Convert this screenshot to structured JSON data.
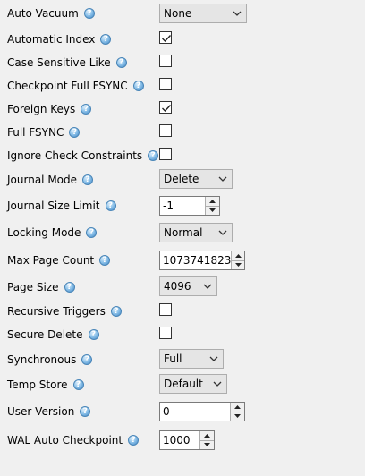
{
  "help_glyph": "?",
  "settings": {
    "auto_vacuum": {
      "label": "Auto Vacuum",
      "value": "None"
    },
    "automatic_index": {
      "label": "Automatic Index",
      "checked": true
    },
    "case_sensitive_like": {
      "label": "Case Sensitive Like",
      "checked": false
    },
    "checkpoint_full_fsync": {
      "label": "Checkpoint Full FSYNC",
      "checked": false
    },
    "foreign_keys": {
      "label": "Foreign Keys",
      "checked": true
    },
    "full_fsync": {
      "label": "Full FSYNC",
      "checked": false
    },
    "ignore_check_constraints": {
      "label": "Ignore Check Constraints",
      "checked": false
    },
    "journal_mode": {
      "label": "Journal Mode",
      "value": "Delete"
    },
    "journal_size_limit": {
      "label": "Journal Size Limit",
      "value": "-1"
    },
    "locking_mode": {
      "label": "Locking Mode",
      "value": "Normal"
    },
    "max_page_count": {
      "label": "Max Page Count",
      "value": "1073741823"
    },
    "page_size": {
      "label": "Page Size",
      "value": "4096"
    },
    "recursive_triggers": {
      "label": "Recursive Triggers",
      "checked": false
    },
    "secure_delete": {
      "label": "Secure Delete",
      "checked": false
    },
    "synchronous": {
      "label": "Synchronous",
      "value": "Full"
    },
    "temp_store": {
      "label": "Temp Store",
      "value": "Default"
    },
    "user_version": {
      "label": "User Version",
      "value": "0"
    },
    "wal_auto_checkpoint": {
      "label": "WAL Auto Checkpoint",
      "value": "1000"
    }
  }
}
